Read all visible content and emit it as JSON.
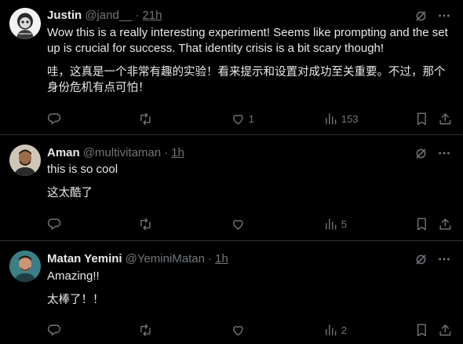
{
  "tweets": [
    {
      "name": "Justin",
      "handle": "@jand__",
      "dot": "·",
      "time": "21h",
      "text_en": "Wow this is a really interesting experiment! Seems like prompting and the set up is crucial for success. That identity crisis is a bit scary though!",
      "text_zh": "哇，这真是一个非常有趣的实验！看来提示和设置对成功至关重要。不过，那个身份危机有点可怕！",
      "likes": "1",
      "views": "153"
    },
    {
      "name": "Aman",
      "handle": "@multivitaman",
      "dot": "·",
      "time": "1h",
      "text_en": "this is so cool",
      "text_zh": "这太酷了",
      "likes": "",
      "views": "5"
    },
    {
      "name": "Matan Yemini",
      "handle": "@YeminiMatan",
      "dot": "·",
      "time": "1h",
      "text_en": "Amazing!!",
      "text_zh": "太棒了！！",
      "likes": "",
      "views": "2"
    }
  ],
  "icons": {
    "reply": "reply-icon",
    "repost": "repost-icon",
    "like": "like-icon",
    "views": "views-icon",
    "bookmark": "bookmark-icon",
    "share": "share-icon",
    "grok": "grok-icon",
    "more": "more-icon"
  },
  "colors": {
    "background": "#000000",
    "text": "#e7e9ea",
    "secondary": "#71767b",
    "divider": "#2f3336"
  }
}
